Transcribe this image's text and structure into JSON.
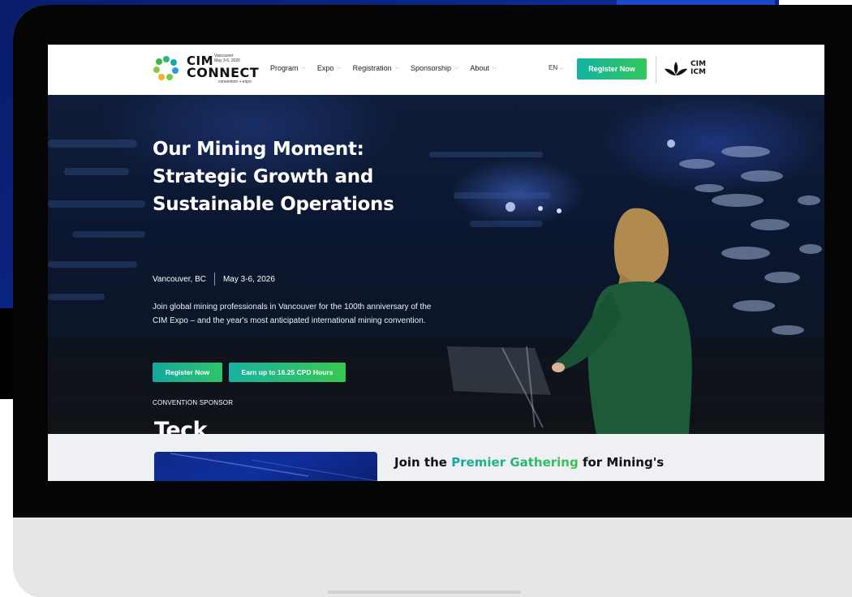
{
  "colors": {
    "brand_gradient_start": "#12b3a4",
    "brand_gradient_end": "#35c65a",
    "hero_bg": "#0d1626",
    "frame_blue": "#0b2a8f",
    "device_body": "#e6e6e8"
  },
  "header": {
    "logo": {
      "line1": "CIM",
      "line2": "CONNECT",
      "small_city": "Vancouver",
      "small_dates": "May 3-6, 2026",
      "tagline": "convention + expo"
    },
    "nav": [
      {
        "label": "Program",
        "icon": "chevron-down-icon"
      },
      {
        "label": "Expo",
        "icon": "chevron-down-icon"
      },
      {
        "label": "Registration",
        "icon": "chevron-down-icon"
      },
      {
        "label": "Sponsorship",
        "icon": "chevron-down-icon"
      },
      {
        "label": "About",
        "icon": "chevron-down-icon"
      }
    ],
    "language": "EN",
    "register_label": "Register Now",
    "cim_logo": {
      "line1": "CIM",
      "line2": "ICM"
    }
  },
  "hero": {
    "title_lines": [
      "Our Mining Moment:",
      "Strategic Growth and",
      "Sustainable Operations"
    ],
    "location": "Vancouver, BC",
    "dates": "May 3-6, 2026",
    "description": "Join global mining professionals in Vancouver for the 100th anniversary of the CIM Expo – and the year's most anticipated international mining convention.",
    "primary_button": "Register Now",
    "secondary_button": "Earn up to 16.25 CPD Hours",
    "sponsor_label": "CONVENTION SPONSOR",
    "sponsor_name": "Teck"
  },
  "section": {
    "heading_prefix": "Join the ",
    "heading_highlight": "Premier Gathering",
    "heading_suffix": " for Mining's Future"
  }
}
